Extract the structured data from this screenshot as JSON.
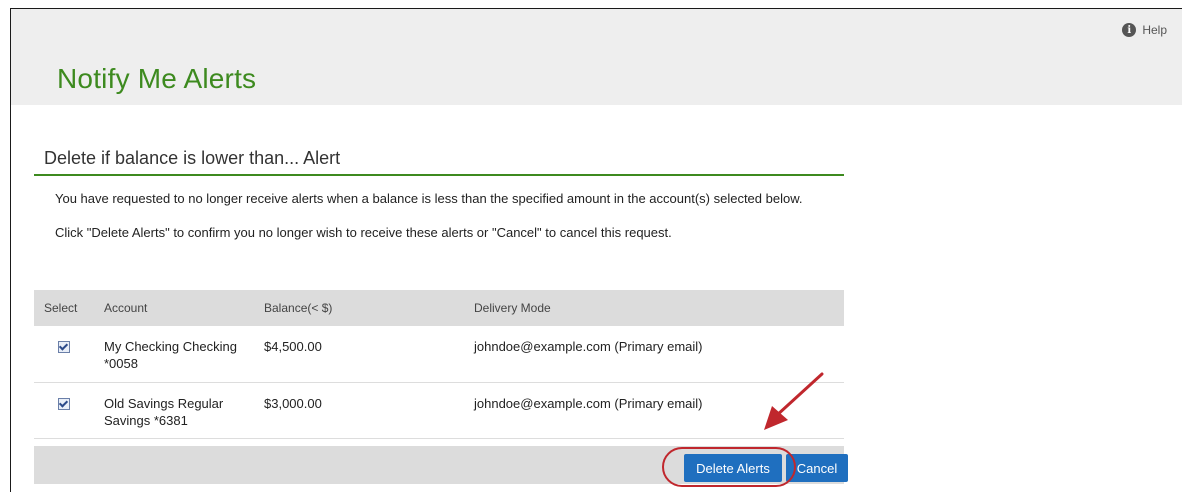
{
  "header": {
    "help_label": "Help",
    "title": "Notify Me Alerts"
  },
  "section": {
    "title": "Delete if balance is lower than... Alert",
    "message_1": "You have requested to no longer receive alerts when a balance is less than the specified amount in the account(s) selected below.",
    "message_2": "Click \"Delete Alerts\" to confirm you no longer wish to receive these alerts or \"Cancel\" to cancel this request."
  },
  "table": {
    "columns": [
      "Select",
      "Account",
      "Balance(< $)",
      "Delivery Mode"
    ],
    "rows": [
      {
        "checked": true,
        "account": "My Checking Checking *0058",
        "balance": "$4,500.00",
        "delivery": "johndoe@example.com (Primary email)"
      },
      {
        "checked": true,
        "account": "Old Savings Regular Savings *6381",
        "balance": "$3,000.00",
        "delivery": "johndoe@example.com (Primary email)"
      }
    ]
  },
  "actions": {
    "delete_label": "Delete Alerts",
    "cancel_label": "Cancel"
  },
  "colors": {
    "title_green": "#3d8a1f",
    "button_blue": "#1f6fbf",
    "annotation_red": "#c0272d"
  }
}
